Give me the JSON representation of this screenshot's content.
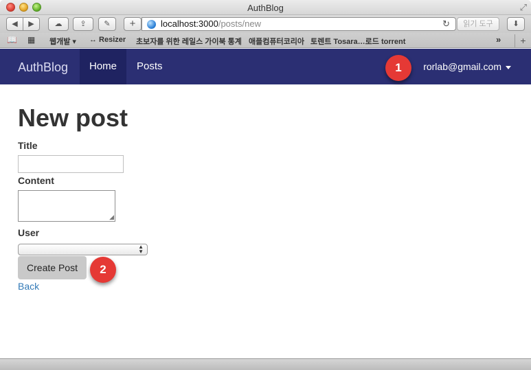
{
  "window": {
    "title": "AuthBlog"
  },
  "toolbar": {
    "back_icon": "◀",
    "forward_icon": "▶",
    "cloud_icon": "☁",
    "share_icon": "⇪",
    "tools_icon": "✎",
    "add_icon": "+",
    "reload_icon": "↻",
    "download_icon": "⬇",
    "address_host": "localhost:3000",
    "address_path": "/posts/new",
    "reader_label": "읽기 도구"
  },
  "bookmarks": {
    "reading_list_icon": "📖",
    "top_sites_icon": "▦",
    "items": [
      "웹개발 ▾",
      "↔ Resizer",
      "초보자를 위한 레일스 가이북 통계",
      "애플컴퓨터코리아",
      "토렌트 Tosara…로드 torrent"
    ],
    "more_icon": "»",
    "new_tab_icon": "+"
  },
  "navbar": {
    "brand": "AuthBlog",
    "links": [
      "Home",
      "Posts"
    ],
    "user_email": "rorlab@gmail.com"
  },
  "callouts": [
    "1",
    "2"
  ],
  "form": {
    "heading": "New post",
    "title_label": "Title",
    "title_value": "",
    "content_label": "Content",
    "content_value": "",
    "user_label": "User",
    "user_selected": "",
    "submit_label": "Create Post",
    "back_label": "Back"
  },
  "colors": {
    "navbar_bg": "#2b2f73",
    "navbar_active": "#1f2361",
    "callout": "#e53935",
    "link": "#337ab7"
  }
}
